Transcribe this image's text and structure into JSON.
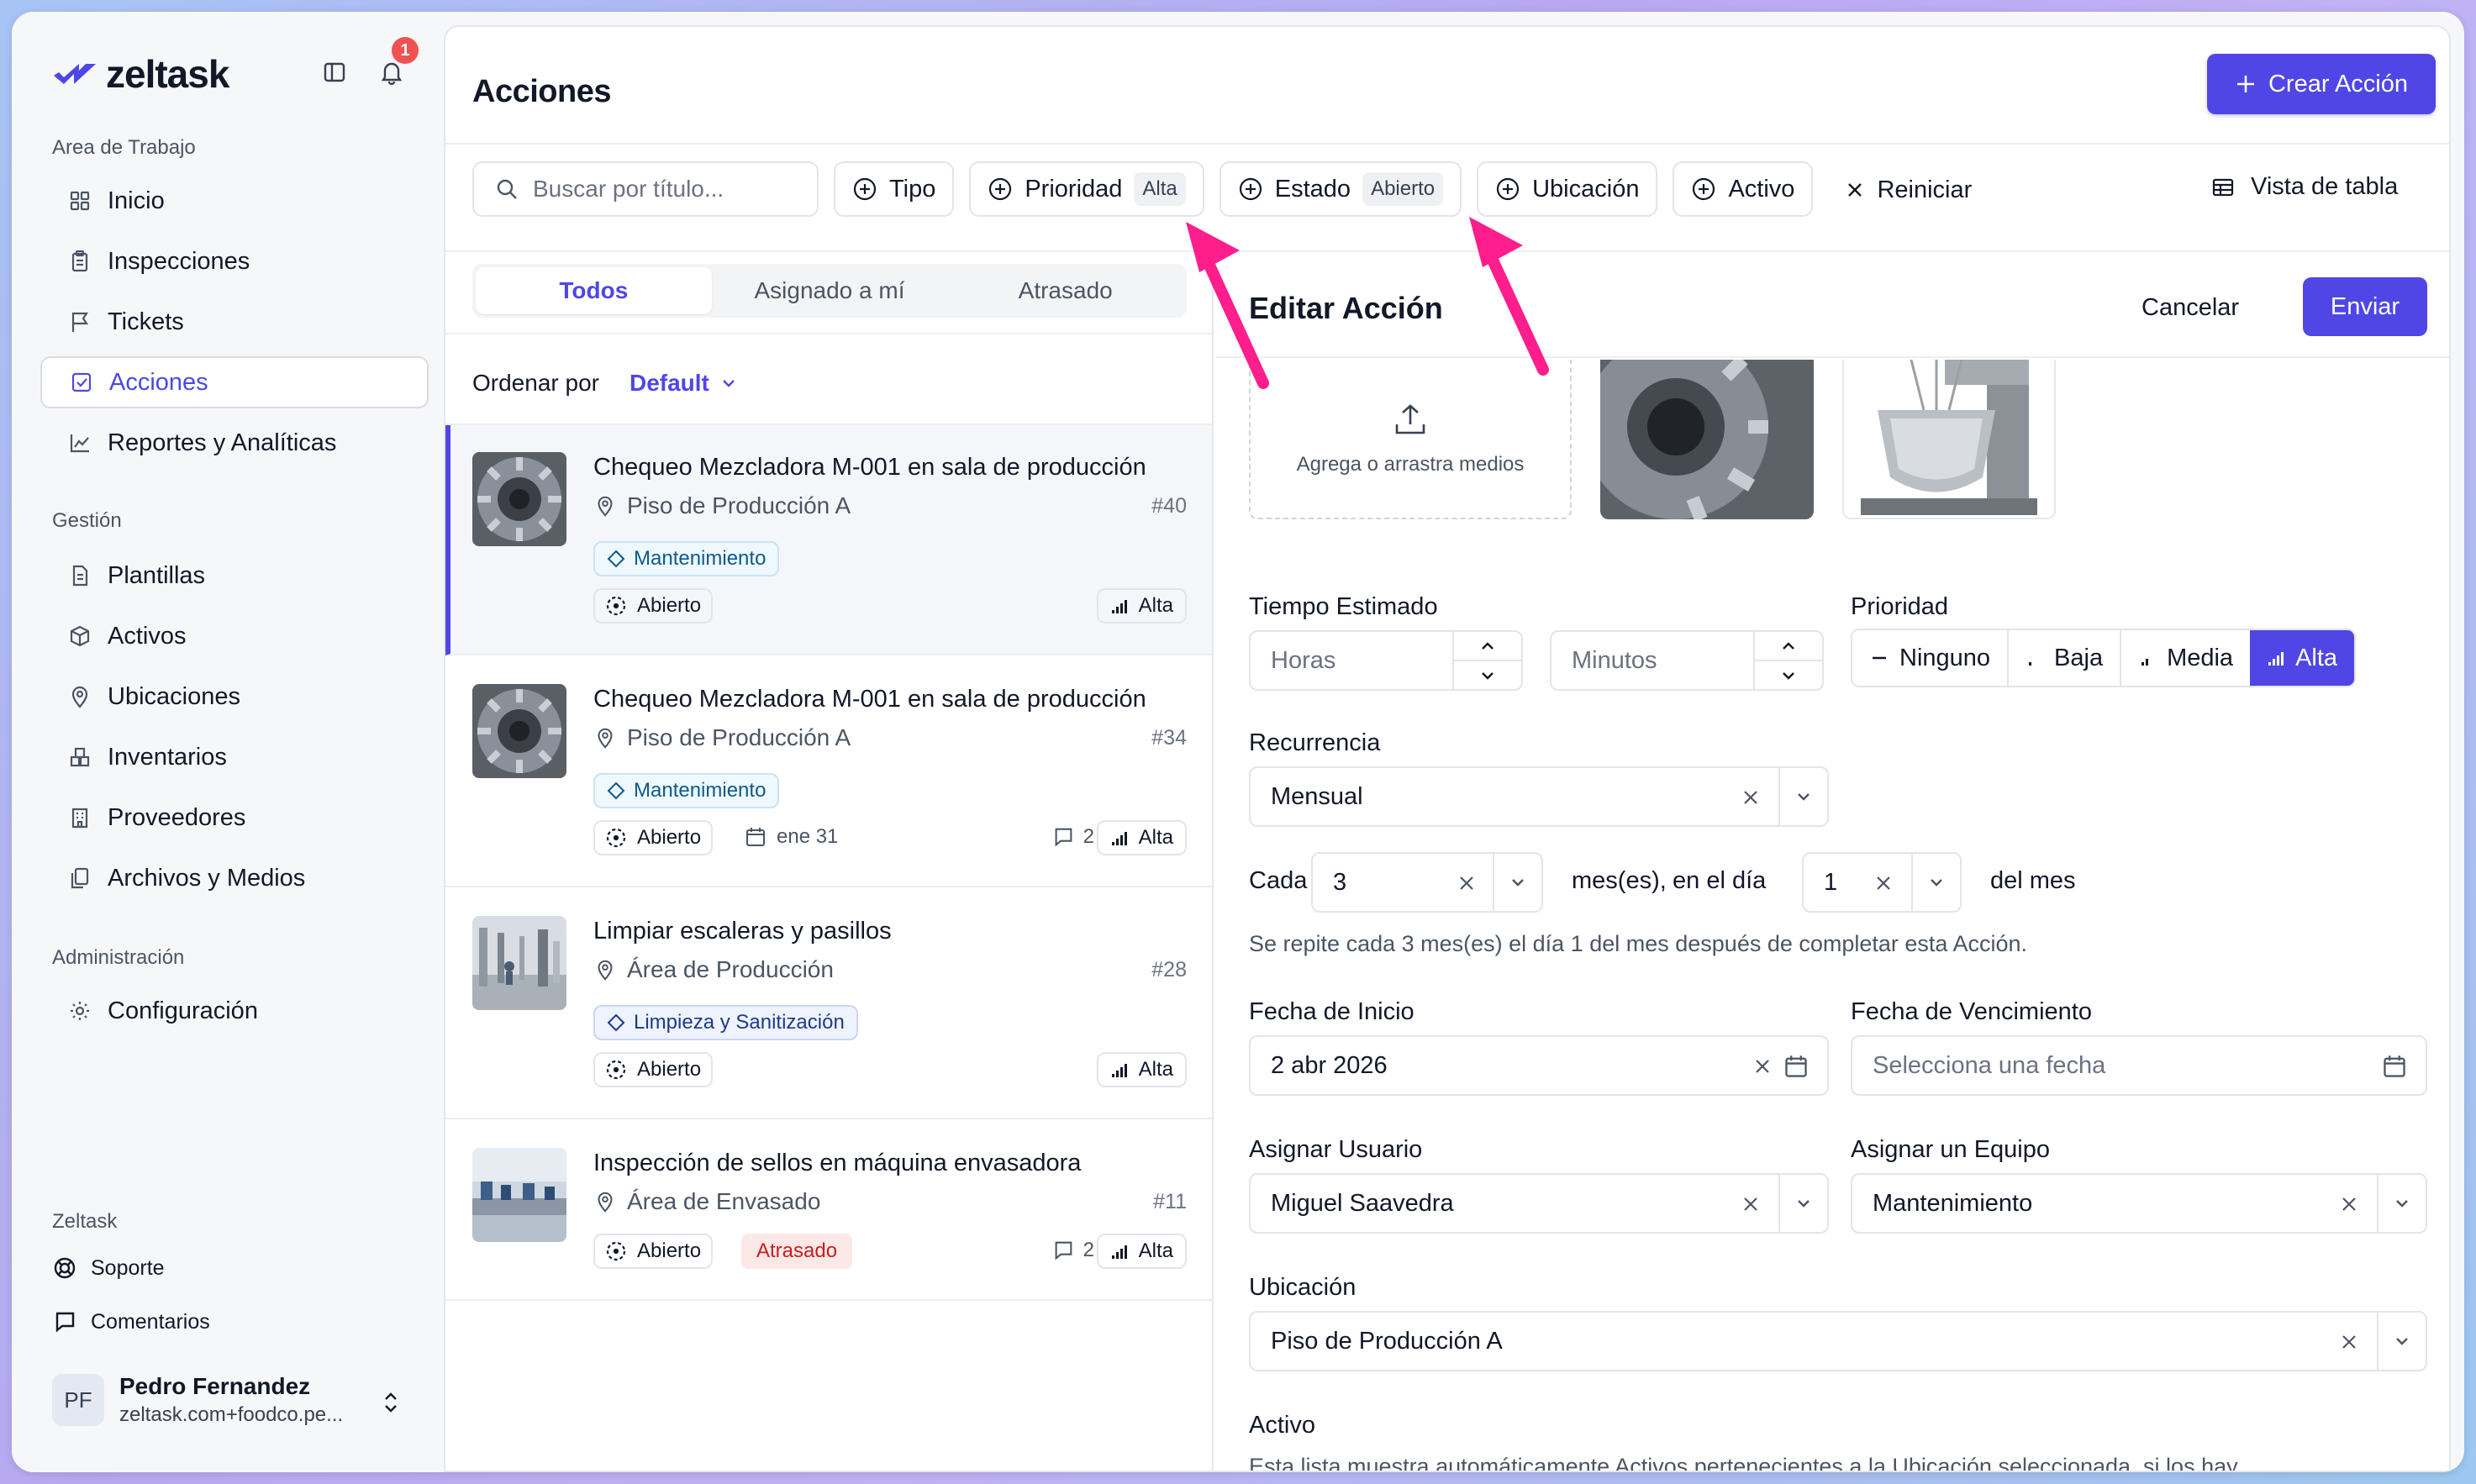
{
  "brand": {
    "name": "zeltask",
    "notif_count": "1"
  },
  "sidebar": {
    "workspace_title": "Area de Trabajo",
    "workspace_items": [
      {
        "label": "Inicio",
        "icon": "grid-icon"
      },
      {
        "label": "Inspecciones",
        "icon": "clipboard-icon"
      },
      {
        "label": "Tickets",
        "icon": "flag-icon"
      },
      {
        "label": "Acciones",
        "icon": "checkbox-icon"
      },
      {
        "label": "Reportes y Analíticas",
        "icon": "chart-icon"
      }
    ],
    "management_title": "Gestión",
    "management_items": [
      {
        "label": "Plantillas",
        "icon": "document-icon"
      },
      {
        "label": "Activos",
        "icon": "cube-icon"
      },
      {
        "label": "Ubicaciones",
        "icon": "pin-icon"
      },
      {
        "label": "Inventarios",
        "icon": "boxes-icon"
      },
      {
        "label": "Proveedores",
        "icon": "building-icon"
      },
      {
        "label": "Archivos y Medios",
        "icon": "files-icon"
      }
    ],
    "admin_title": "Administración",
    "admin_items": [
      {
        "label": "Configuración",
        "icon": "gear-icon"
      }
    ],
    "footer_title": "Zeltask",
    "footer_items": [
      {
        "label": "Soporte",
        "icon": "lifebuoy-icon"
      },
      {
        "label": "Comentarios",
        "icon": "comment-icon"
      }
    ],
    "user": {
      "initials": "PF",
      "name": "Pedro Fernandez",
      "email": "zeltask.com+foodco.pe..."
    }
  },
  "header": {
    "title": "Acciones",
    "create_label": "Crear Acción"
  },
  "filters": {
    "search_placeholder": "Buscar por título...",
    "tipo": "Tipo",
    "prioridad": "Prioridad",
    "prioridad_tag": "Alta",
    "estado": "Estado",
    "estado_tag": "Abierto",
    "ubicacion": "Ubicación",
    "activo": "Activo",
    "reset": "Reiniciar",
    "table_view": "Vista de tabla"
  },
  "list": {
    "tabs": [
      "Todos",
      "Asignado a mí",
      "Atrasado"
    ],
    "sort_label": "Ordenar por",
    "sort_value": "Default",
    "cards": [
      {
        "title": "Chequeo Mezcladora M-001 en sala de producción",
        "location": "Piso de Producción A",
        "number": "#40",
        "category": "Mantenimiento",
        "status": "Abierto",
        "priority": "Alta",
        "date": "",
        "comments": "",
        "late": ""
      },
      {
        "title": "Chequeo Mezcladora M-001 en sala de producción",
        "location": "Piso de Producción A",
        "number": "#34",
        "category": "Mantenimiento",
        "status": "Abierto",
        "priority": "Alta",
        "date": "ene 31",
        "comments": "2",
        "late": ""
      },
      {
        "title": "Limpiar escaleras y pasillos",
        "location": "Área de Producción",
        "number": "#28",
        "category": "Limpieza y Sanitización",
        "status": "Abierto",
        "priority": "Alta",
        "date": "",
        "comments": "",
        "late": ""
      },
      {
        "title": "Inspección de sellos en máquina envasadora",
        "location": "Área de Envasado",
        "number": "#11",
        "category": "",
        "status": "Abierto",
        "priority": "Alta",
        "date": "",
        "comments": "2",
        "late": "Atrasado"
      }
    ]
  },
  "edit": {
    "title": "Editar Acción",
    "cancel": "Cancelar",
    "send": "Enviar",
    "upload_label": "Agrega o arrastra medios",
    "time_label": "Tiempo Estimado",
    "hours_placeholder": "Horas",
    "minutes_placeholder": "Minutos",
    "priority_label": "Prioridad",
    "priority_options": [
      "Ninguno",
      "Baja",
      "Media",
      "Alta"
    ],
    "priority_selected": "Alta",
    "recurrence_label": "Recurrencia",
    "recurrence_value": "Mensual",
    "every_label": "Cada",
    "every_value": "3",
    "months_label": "mes(es),",
    "on_day_label": "en el día",
    "day_value": "1",
    "of_month_label": "del mes",
    "recurrence_hint": "Se repite cada 3 mes(es) el día 1 del mes después de completar esta Acción.",
    "start_label": "Fecha de Inicio",
    "start_value": "2 abr 2026",
    "due_label": "Fecha de Vencimiento",
    "due_placeholder": "Selecciona una fecha",
    "user_label": "Asignar Usuario",
    "user_value": "Miguel Saavedra",
    "team_label": "Asignar un Equipo",
    "team_value": "Mantenimiento",
    "location_label": "Ubicación",
    "location_value": "Piso de Producción A",
    "asset_label": "Activo",
    "asset_hint": "Esta lista muestra automáticamente Activos pertenecientes a la Ubicación seleccionada, si los hay."
  },
  "colors": {
    "accent": "#4f46e5",
    "annotation_arrow": "#ff1e8c"
  }
}
